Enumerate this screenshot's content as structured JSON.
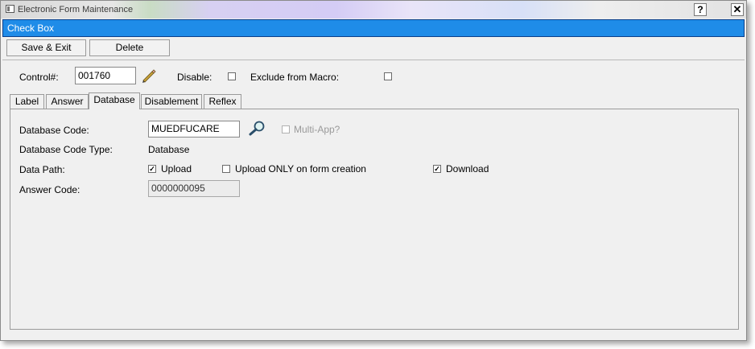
{
  "window": {
    "title": "Electronic Form Maintenance",
    "help_label": "?",
    "close_label": "✕",
    "icons": {
      "app": "window-icon",
      "edit": "pencil-icon",
      "lookup": "magnifier-icon"
    }
  },
  "header": {
    "title": "Check Box"
  },
  "toolbar": {
    "save_exit_label": "Save & Exit",
    "delete_label": "Delete"
  },
  "control": {
    "control_label": "Control#:",
    "control_value": "001760",
    "disable_label": "Disable:",
    "disable_checked": false,
    "exclude_label": "Exclude from Macro:",
    "exclude_checked": false
  },
  "tabs": [
    {
      "label": "Label",
      "active": false
    },
    {
      "label": "Answer",
      "active": false
    },
    {
      "label": "Database",
      "active": true
    },
    {
      "label": "Disablement",
      "active": false
    },
    {
      "label": "Reflex",
      "active": false
    }
  ],
  "database": {
    "code_label": "Database Code:",
    "code_value": "MUEDFUCARE",
    "multi_app_label": "Multi-App?",
    "multi_app_checked": false,
    "code_type_label": "Database Code Type:",
    "code_type_value": "Database",
    "data_path_label": "Data Path:",
    "upload_label": "Upload",
    "upload_checked": true,
    "upload_only_label": "Upload ONLY on form creation",
    "upload_only_checked": false,
    "download_label": "Download",
    "download_checked": true,
    "answer_code_label": "Answer Code:",
    "answer_code_value": "0000000095"
  },
  "colors": {
    "header_bar": "#1f8ce8",
    "panel": "#f0f0f0"
  }
}
